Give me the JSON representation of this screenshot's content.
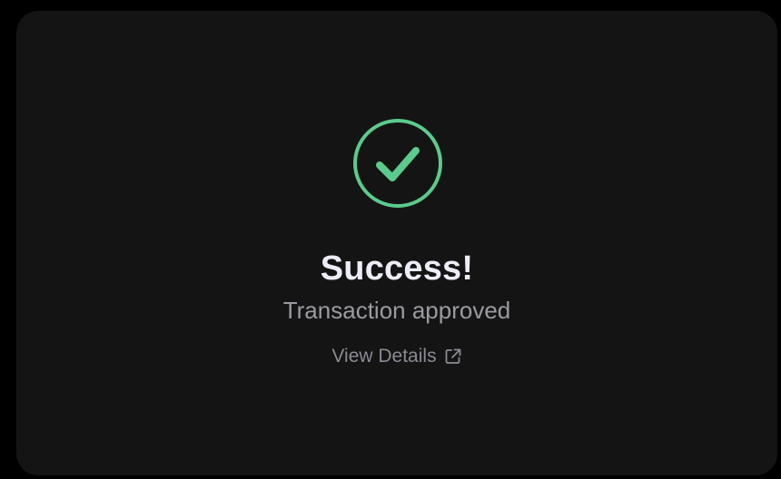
{
  "status": {
    "title": "Success!",
    "message": "Transaction approved",
    "link_label": "View Details"
  },
  "icons": {
    "status_icon": "check-circle-icon",
    "link_icon": "external-link-icon"
  },
  "colors": {
    "page_background": "#000000",
    "card_background": "#141414",
    "success_accent": "#5BCB8B",
    "title_text": "#ECEDF6",
    "subtitle_text": "#9A9AA3",
    "link_text": "#8A8A92"
  }
}
